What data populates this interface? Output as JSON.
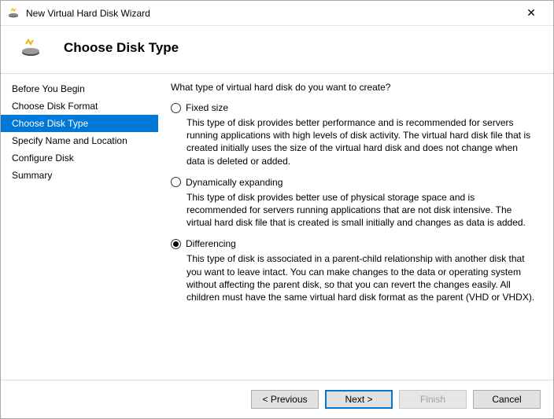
{
  "window": {
    "title": "New Virtual Hard Disk Wizard"
  },
  "header": {
    "title": "Choose Disk Type"
  },
  "sidebar": {
    "items": [
      {
        "label": "Before You Begin",
        "selected": false
      },
      {
        "label": "Choose Disk Format",
        "selected": false
      },
      {
        "label": "Choose Disk Type",
        "selected": true
      },
      {
        "label": "Specify Name and Location",
        "selected": false
      },
      {
        "label": "Configure Disk",
        "selected": false
      },
      {
        "label": "Summary",
        "selected": false
      }
    ]
  },
  "content": {
    "prompt": "What type of virtual hard disk do you want to create?",
    "options": [
      {
        "label": "Fixed size",
        "checked": false,
        "desc": "This type of disk provides better performance and is recommended for servers running applications with high levels of disk activity. The virtual hard disk file that is created initially uses the size of the virtual hard disk and does not change when data is deleted or added."
      },
      {
        "label": "Dynamically expanding",
        "checked": false,
        "desc": "This type of disk provides better use of physical storage space and is recommended for servers running applications that are not disk intensive. The virtual hard disk file that is created is small initially and changes as data is added."
      },
      {
        "label": "Differencing",
        "checked": true,
        "desc": "This type of disk is associated in a parent-child relationship with another disk that you want to leave intact. You can make changes to the data or operating system without affecting the parent disk, so that you can revert the changes easily. All children must have the same virtual hard disk format as the parent (VHD or VHDX)."
      }
    ]
  },
  "footer": {
    "previous": "< Previous",
    "next": "Next >",
    "finish": "Finish",
    "cancel": "Cancel"
  }
}
